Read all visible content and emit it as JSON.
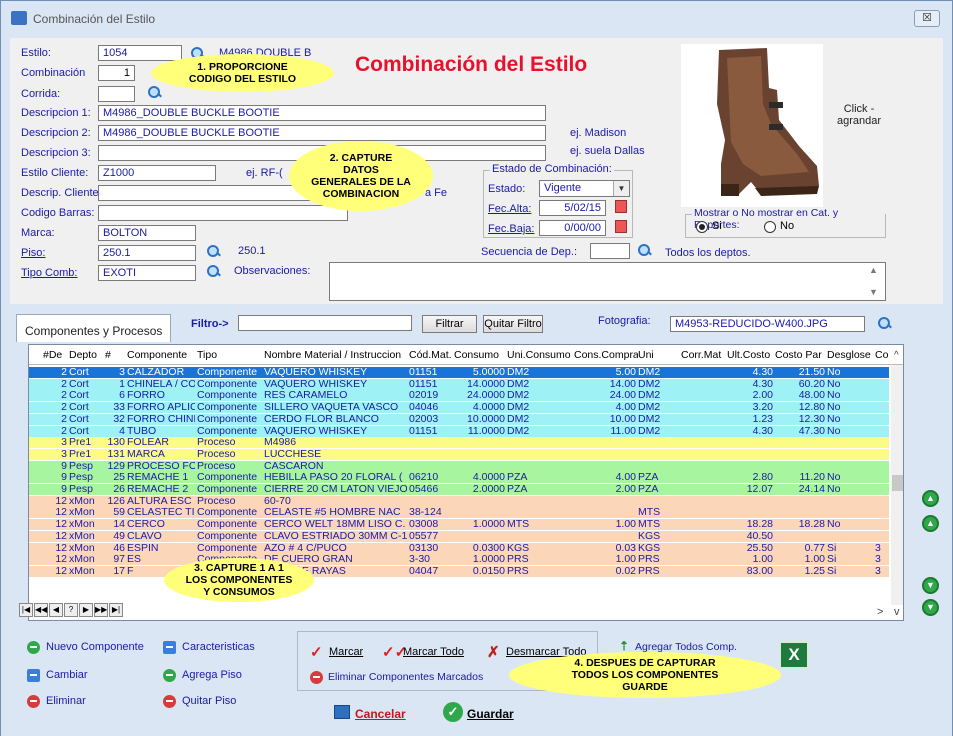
{
  "window": {
    "title": "Combinación del Estilo",
    "close_label": "☒"
  },
  "header": {
    "big_title": "Combinación del Estilo"
  },
  "form": {
    "estilo": {
      "label": "Estilo:",
      "value": "1054",
      "desc": "M4986 DOUBLE B"
    },
    "combinacion": {
      "label": "Combinación",
      "value": "1"
    },
    "corrida": {
      "label": "Corrida:",
      "value": ""
    },
    "descripcion1": {
      "label": "Descripcion 1:",
      "value": "M4986_DOUBLE BUCKLE BOOTIE"
    },
    "descripcion2": {
      "label": "Descripcion 2:",
      "value": "M4986_DOUBLE BUCKLE BOOTIE",
      "hint": "ej. Madison"
    },
    "descripcion3": {
      "label": "Descripcion 3:",
      "value": "",
      "hint": "ej. suela Dallas"
    },
    "estilo_cliente": {
      "label": "Estilo Cliente:",
      "value": "Z1000",
      "hint": "ej. RF-("
    },
    "descrip_cliente": {
      "label": "Descrip. Cliente",
      "value": "",
      "hint": "a Fe"
    },
    "codigo_barras": {
      "label": "Codigo Barras:",
      "value": ""
    },
    "marca": {
      "label": "Marca:",
      "value": "BOLTON"
    },
    "piso": {
      "label": "Piso:",
      "value": "250.1",
      "desc": "250.1"
    },
    "tipo_comb": {
      "label": "Tipo Comb:",
      "value": "EXOTI"
    },
    "observaciones": {
      "label": "Observaciones:",
      "value": ""
    }
  },
  "estado": {
    "group_title": "Estado de Combinación:",
    "estado_label": "Estado:",
    "estado_value": "Vigente",
    "fec_alta_label": "Fec.Alta:",
    "fec_alta_value": "5/02/15",
    "fec_baja_label": "Fec.Baja:",
    "fec_baja_value": "0/00/00"
  },
  "secuencia": {
    "label": "Secuencia de Dep.:",
    "value": "",
    "desc": "Todos los deptos."
  },
  "photo": {
    "click_label": "Click -\nagrandar"
  },
  "mostrar": {
    "group_title": "Mostrar o No mostrar en Cat. y Reportes:",
    "si": "Si",
    "no": "No"
  },
  "callouts": {
    "c1": "1. PROPORCIONE\nCODIGO DEL ESTILO",
    "c2": "2. CAPTURE\nDATOS\nGENERALES DE LA\nCOMBINACION",
    "c3": "3. CAPTURE 1 A 1\nLOS COMPONENTES\nY CONSUMOS",
    "c4": "4. DESPUES DE CAPTURAR\nTODOS LOS COMPONENTES\nGUARDE"
  },
  "tabs": {
    "componentes": "Componentes y Procesos"
  },
  "filter": {
    "label": "Filtro->",
    "value": "",
    "filtrar": "Filtrar",
    "quitar": "Quitar Filtro"
  },
  "fotografia": {
    "label": "Fotografia:",
    "value": "M4953-REDUCIDO-W400.JPG"
  },
  "grid": {
    "columns": [
      "#De",
      "Depto",
      "#",
      "Componente",
      "Tipo",
      "Nombre Material / Instruccion",
      "Cód.Mat.",
      "Consumo",
      "Uni.Consumo",
      "Cons.Compra",
      "Uni",
      "Corr.Mat",
      "Ult.Costo",
      "Costo Par",
      "Desglose",
      "Co"
    ],
    "rows": [
      {
        "style": "sel",
        "c": [
          "2",
          "Cort",
          "3",
          "CALZADOR",
          "Componente",
          "VAQUERO WHISKEY",
          "01151",
          "5.0000",
          "DM2",
          "5.00",
          "DM2",
          "",
          "4.30",
          "21.50",
          "No",
          ""
        ]
      },
      {
        "style": "cyan",
        "c": [
          "2",
          "Cort",
          "1",
          "CHINELA / CO",
          "Componente",
          "VAQUERO WHISKEY",
          "01151",
          "14.0000",
          "DM2",
          "14.00",
          "DM2",
          "",
          "4.30",
          "60.20",
          "No",
          ""
        ]
      },
      {
        "style": "cyan",
        "c": [
          "2",
          "Cort",
          "6",
          "FORRO",
          "Componente",
          "RES CARAMELO",
          "02019",
          "24.0000",
          "DM2",
          "24.00",
          "DM2",
          "",
          "2.00",
          "48.00",
          "No",
          ""
        ]
      },
      {
        "style": "cyan",
        "c": [
          "2",
          "Cort",
          "33",
          "FORRO APLIC",
          "Componente",
          "SILLERO VAQUETA VASCO",
          "04046",
          "4.0000",
          "DM2",
          "4.00",
          "DM2",
          "",
          "3.20",
          "12.80",
          "No",
          ""
        ]
      },
      {
        "style": "cyan",
        "c": [
          "2",
          "Cort",
          "32",
          "FORRO CHINE",
          "Componente",
          "CERDO FLOR BLANCO",
          "02003",
          "10.0000",
          "DM2",
          "10.00",
          "DM2",
          "",
          "1.23",
          "12.30",
          "No",
          ""
        ]
      },
      {
        "style": "cyan",
        "c": [
          "2",
          "Cort",
          "4",
          "TUBO",
          "Componente",
          "VAQUERO WHISKEY",
          "01151",
          "11.0000",
          "DM2",
          "11.00",
          "DM2",
          "",
          "4.30",
          "47.30",
          "No",
          ""
        ]
      },
      {
        "style": "yellow",
        "c": [
          "3",
          "Pre1",
          "130",
          "FOLEAR",
          "Proceso",
          "M4986",
          "",
          "",
          "",
          "",
          "",
          "",
          "",
          "",
          "",
          ""
        ]
      },
      {
        "style": "yellow",
        "c": [
          "3",
          "Pre1",
          "131",
          "MARCA",
          "Proceso",
          "LUCCHESE",
          "",
          "",
          "",
          "",
          "",
          "",
          "",
          "",
          "",
          ""
        ]
      },
      {
        "style": "green",
        "c": [
          "9",
          "Pesp",
          "129",
          "PROCESO FO",
          "Proceso",
          "CASCARON",
          "",
          "",
          "",
          "",
          "",
          "",
          "",
          "",
          "",
          ""
        ]
      },
      {
        "style": "green",
        "c": [
          "9",
          "Pesp",
          "25",
          "REMACHE 1",
          "Componente",
          "HEBILLA PASO 20 FLORAL (",
          "06210",
          "4.0000",
          "PZA",
          "4.00",
          "PZA",
          "",
          "2.80",
          "11.20",
          "No",
          ""
        ]
      },
      {
        "style": "green",
        "c": [
          "9",
          "Pesp",
          "26",
          "REMACHE 2",
          "Componente",
          "CIERRE 20 CM LATON VIEJO",
          "05466",
          "2.0000",
          "PZA",
          "2.00",
          "PZA",
          "",
          "12.07",
          "24.14",
          "No",
          ""
        ]
      },
      {
        "style": "peach",
        "c": [
          "12",
          "xMon",
          "126",
          "ALTURA ESC",
          "Proceso",
          "60-70",
          "",
          "",
          "",
          "",
          "",
          "",
          "",
          "",
          "",
          ""
        ]
      },
      {
        "style": "peach",
        "c": [
          "12",
          "xMon",
          "59",
          "CELASTEC TI",
          "Componente",
          "CELASTE #5 HOMBRE NAC",
          "38-124",
          "",
          "",
          "",
          "MTS",
          "",
          "",
          "",
          "",
          ""
        ]
      },
      {
        "style": "peach",
        "c": [
          "12",
          "xMon",
          "14",
          "CERCO",
          "Componente",
          "CERCO WELT 18MM LISO C.",
          "03008",
          "1.0000",
          "MTS",
          "1.00",
          "MTS",
          "",
          "18.28",
          "18.28",
          "No",
          ""
        ]
      },
      {
        "style": "peach",
        "c": [
          "12",
          "xMon",
          "49",
          "CLAVO",
          "Componente",
          "CLAVO ESTRIADO 30MM C-1",
          "05577",
          "",
          "",
          "",
          "KGS",
          "",
          "40.50",
          "",
          "",
          ""
        ]
      },
      {
        "style": "peach",
        "c": [
          "12",
          "xMon",
          "46",
          "ESPIN",
          "Componente",
          "AZO # 4 C/PUCO",
          "03130",
          "0.0300",
          "KGS",
          "0.03",
          "KGS",
          "",
          "25.50",
          "0.77",
          "Si",
          "3"
        ]
      },
      {
        "style": "peach",
        "c": [
          "12",
          "xMon",
          "97",
          "ES",
          "Componente",
          "DE CUERO GRAN",
          "3-30",
          "1.0000",
          "PRS",
          "1.00",
          "PRS",
          "",
          "1.00",
          "1.00",
          "Si",
          "3"
        ]
      },
      {
        "style": "peach",
        "c": [
          "12",
          "xMon",
          "17",
          "F",
          "Componente",
          "LLON DE RAYAS",
          "04047",
          "0.0150",
          "PRS",
          "0.02",
          "PRS",
          "",
          "83.00",
          "1.25",
          "Si",
          "3"
        ]
      }
    ]
  },
  "nav": [
    "|◀",
    "◀◀",
    "◀",
    "?",
    "▶",
    "▶▶",
    "▶|"
  ],
  "buttons": {
    "nuevo_componente": "Nuevo Componente",
    "caracteristicas": "Caracteristicas",
    "cambiar": "Cambiar",
    "agrega_piso": "Agrega Piso",
    "eliminar": "Eliminar",
    "quitar_piso": "Quitar Piso",
    "marcar": "Marcar",
    "marcar_todo": "Marcar Todo",
    "desmarcar_todo": "Desmarcar Todo",
    "eliminar_marcados": "Eliminar Componentes Marcados",
    "agregar_todos": "Agregar Todos Comp.",
    "cancelar": "Cancelar",
    "guardar": "Guardar"
  }
}
